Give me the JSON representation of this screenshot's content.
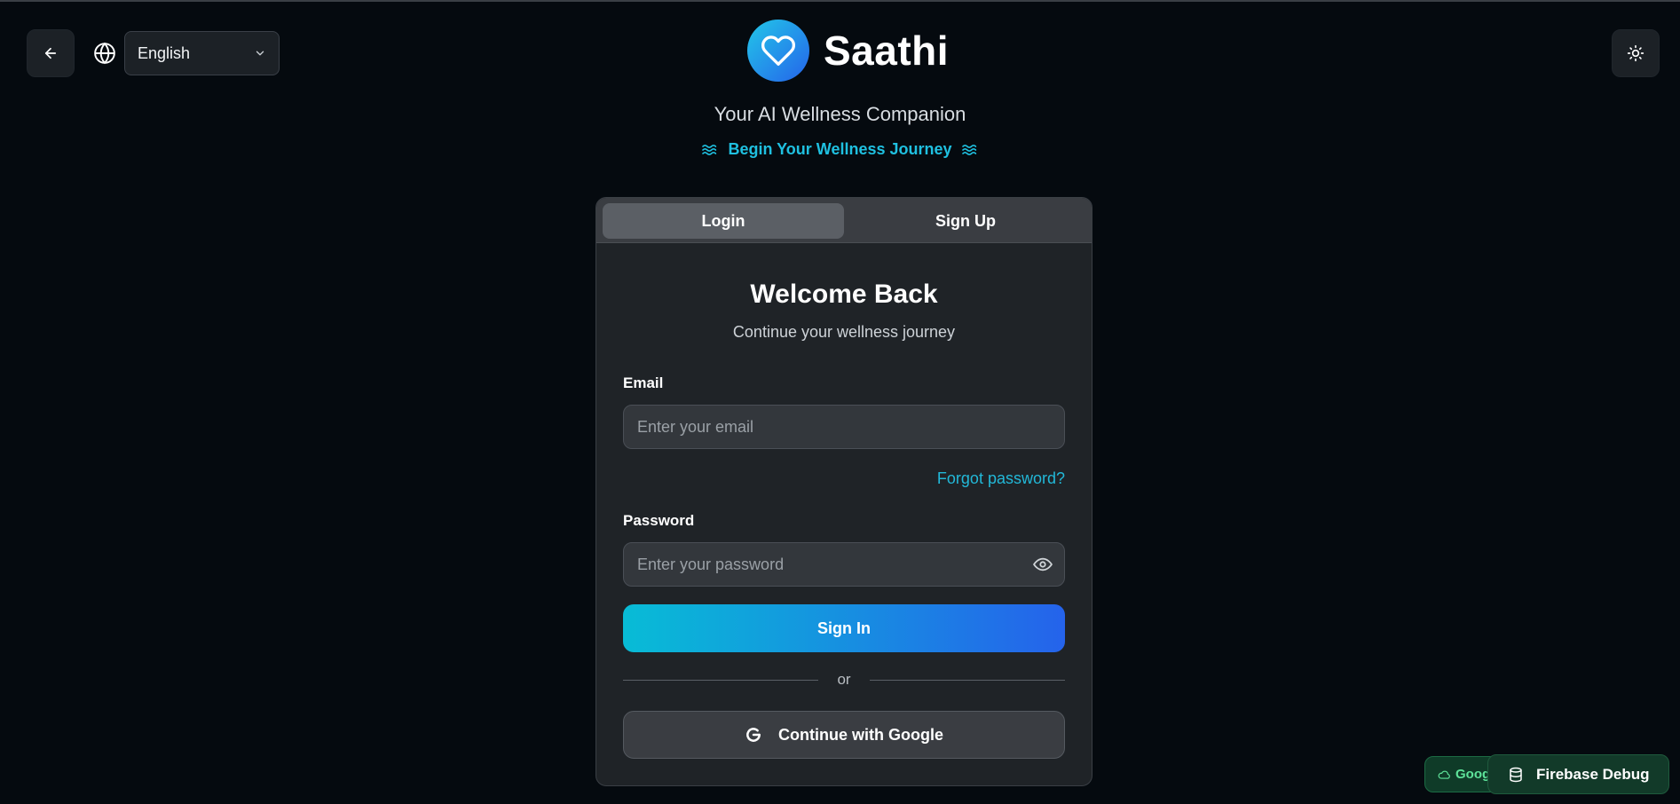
{
  "header": {
    "back_icon": "arrow-left-icon",
    "language_icon": "globe-icon",
    "language_selected": "English",
    "theme_icon": "sun-icon"
  },
  "brand": {
    "logo_icon": "heart-icon",
    "name": "Saathi",
    "tagline": "Your AI Wellness Companion",
    "journey": "Begin Your Wellness Journey",
    "journey_icon": "waves-icon"
  },
  "tabs": [
    {
      "label": "Login",
      "active": true
    },
    {
      "label": "Sign Up",
      "active": false
    }
  ],
  "form": {
    "title": "Welcome Back",
    "subtitle": "Continue your wellness journey",
    "email_label": "Email",
    "email_placeholder": "Enter your email",
    "email_value": "",
    "forgot_label": "Forgot password?",
    "password_label": "Password",
    "password_placeholder": "Enter your password",
    "password_value": "",
    "password_toggle_icon": "eye-icon",
    "signin_label": "Sign In",
    "divider_label": "or",
    "google_label": "Continue with Google",
    "google_icon": "google-icon"
  },
  "footer": {
    "cloud_badge_label": "Goog",
    "cloud_icon": "cloud-icon",
    "debug_label": "Firebase Debug",
    "debug_icon": "database-icon"
  },
  "colors": {
    "background": "#050a0f",
    "card": "#1f2327",
    "accent": "#1fc0e0",
    "gradient_start": "#08bcd6",
    "gradient_end": "#2563eb",
    "debug_green": "#123a29"
  }
}
